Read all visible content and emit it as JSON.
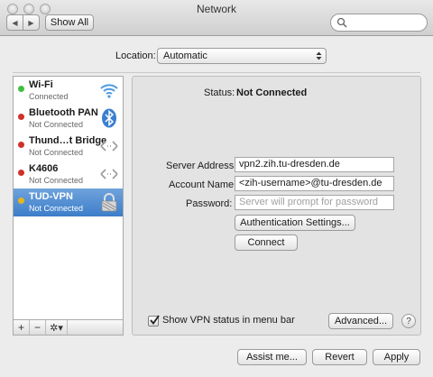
{
  "window": {
    "title": "Network",
    "show_all_label": "Show All",
    "search_placeholder": ""
  },
  "location": {
    "label": "Location:",
    "value": "Automatic"
  },
  "services": [
    {
      "name": "Wi-Fi",
      "status": "Connected",
      "status_color": "#3fbf3f",
      "icon": "wifi-icon"
    },
    {
      "name": "Bluetooth PAN",
      "status": "Not Connected",
      "status_color": "#d0302a",
      "icon": "bluetooth-icon"
    },
    {
      "name": "Thund…t Bridge",
      "status": "Not Connected",
      "status_color": "#d0302a",
      "icon": "thunderbolt-bridge-icon"
    },
    {
      "name": "K4606",
      "status": "Not Connected",
      "status_color": "#d0302a",
      "icon": "ethernet-arrows-icon"
    },
    {
      "name": "TUD-VPN",
      "status": "Not Connected",
      "status_color": "#e7b51c",
      "icon": "vpn-lock-icon"
    }
  ],
  "selected_service": "TUD-VPN",
  "sidebar_buttons": {
    "add": "+",
    "remove": "−",
    "action": "✲▾"
  },
  "detail": {
    "status_label": "Status:",
    "status_value": "Not Connected",
    "server_label": "Server Address:",
    "server_value": "vpn2.zih.tu-dresden.de",
    "account_label": "Account Name:",
    "account_value": "<zih-username>@tu-dresden.de",
    "password_label": "Password:",
    "password_placeholder": "Server will prompt for password",
    "auth_button": "Authentication Settings...",
    "connect_button": "Connect",
    "show_status_label": "Show VPN status in menu bar",
    "show_status_checked": true,
    "advanced_button": "Advanced...",
    "help_button": "?"
  },
  "footer": {
    "assist_button": "Assist me...",
    "revert_button": "Revert",
    "apply_button": "Apply"
  },
  "colors": {
    "selection": "#3c7dc9",
    "connected": "#3fbf3f",
    "not_connected": "#d0302a",
    "vpn_pending": "#e7b51c"
  }
}
